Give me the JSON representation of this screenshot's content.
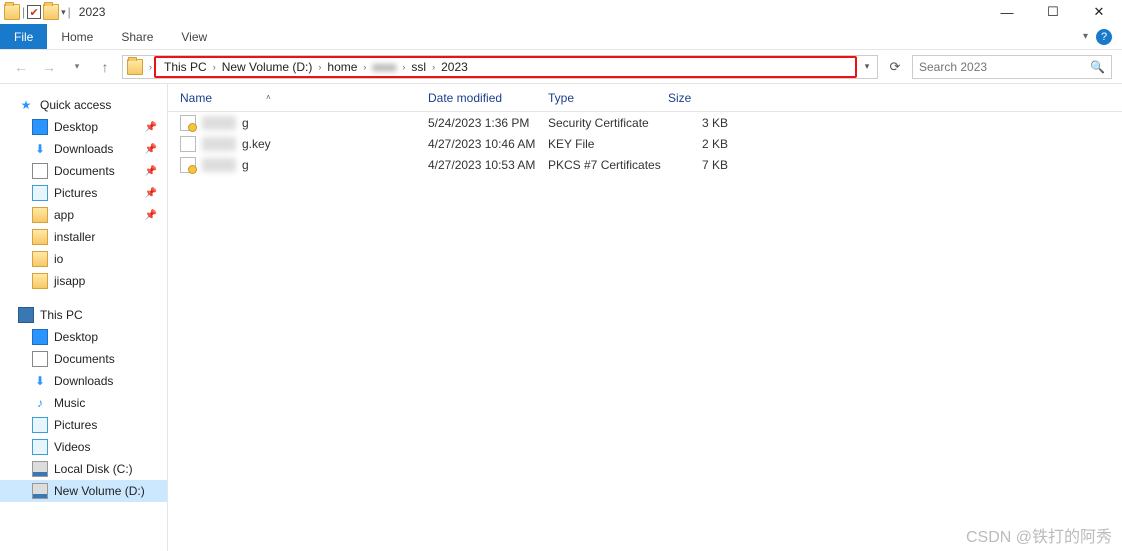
{
  "titlebar": {
    "title": "2023"
  },
  "win": {
    "min": "—",
    "max": "☐",
    "close": "✕"
  },
  "ribbon": {
    "file": "File",
    "home": "Home",
    "share": "Share",
    "view": "View",
    "help": "?"
  },
  "nav": {
    "back": "←",
    "fwd": "→",
    "up": "↑",
    "drop": "▾",
    "refresh": "⟳"
  },
  "breadcrumbs": [
    "This PC",
    "New Volume (D:)",
    "home",
    "",
    "ssl",
    "2023"
  ],
  "search": {
    "placeholder": "Search 2023",
    "mag": "🔍"
  },
  "sidebar": {
    "quick": "Quick access",
    "items1": [
      "Desktop",
      "Downloads",
      "Documents",
      "Pictures",
      "app",
      "installer",
      "io",
      "jisapp"
    ],
    "pc": "This PC",
    "items2": [
      "Desktop",
      "Documents",
      "Downloads",
      "Music",
      "Pictures",
      "Videos",
      "Local Disk (C:)",
      "New Volume (D:)"
    ]
  },
  "cols": {
    "name": "Name",
    "date": "Date modified",
    "type": "Type",
    "size": "Size"
  },
  "rows": [
    {
      "ext": "g",
      "date": "5/24/2023 1:36 PM",
      "type": "Security Certificate",
      "size": "3 KB",
      "icon": "cert"
    },
    {
      "ext": "g.key",
      "date": "4/27/2023 10:46 AM",
      "type": "KEY File",
      "size": "2 KB",
      "icon": "file"
    },
    {
      "ext": "g",
      "date": "4/27/2023 10:53 AM",
      "type": "PKCS #7 Certificates",
      "size": "7 KB",
      "icon": "cert"
    }
  ],
  "watermark": "CSDN @铁打的阿秀"
}
